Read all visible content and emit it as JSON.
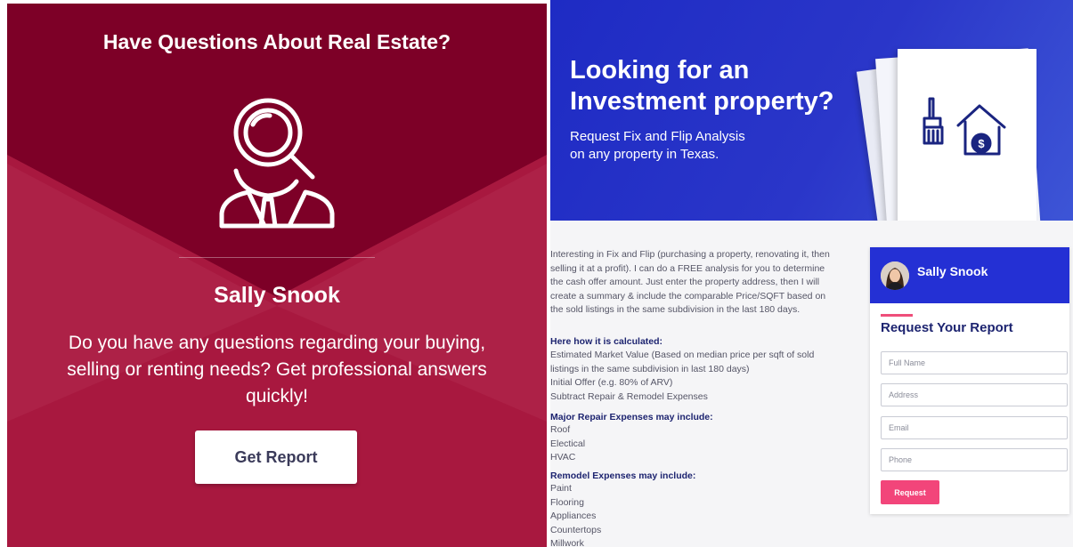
{
  "left_card": {
    "title": "Have Questions About Real Estate?",
    "agent_name": "Sally Snook",
    "body": "Do you have any questions regarding your buying, selling or renting needs? Get professional answers quickly!",
    "button_label": "Get Report",
    "icon": "agent-search-icon",
    "colors": {
      "dark": "#7d0027",
      "mid": "#a8183f",
      "light": "#b0294f"
    }
  },
  "right_page": {
    "hero": {
      "title_line1": "Looking for an",
      "title_line2": "Investment property?",
      "subtitle_line1": "Request Fix and Flip Analysis",
      "subtitle_line2": "on any property in Texas.",
      "icon": "fix-and-flip-house-icon",
      "color": "#2430d4"
    },
    "intro": "Interesting in Fix and Flip (purchasing a property, renovating it, then selling it at a profit). I can do a FREE analysis for you to determine the cash offer amount. Just enter the property address, then I will create a summary & include the comparable Price/SQFT based on the sold listings in the same subdivision in the last 180 days.",
    "calculation": {
      "heading": "Here how it is calculated:",
      "items": [
        "Estimated Market Value (Based on median price per sqft of sold listings in the same subdivision in last 180 days)",
        "Initial Offer (e.g. 80% of ARV)",
        "Subtract Repair & Remodel Expenses"
      ]
    },
    "repair": {
      "heading": "Major Repair Expenses may include:",
      "items": [
        "Roof",
        "Electical",
        "HVAC"
      ]
    },
    "remodel": {
      "heading": "Remodel Expenses may include:",
      "items": [
        "Paint",
        "Flooring",
        "Appliances",
        "Countertops",
        "Millwork"
      ]
    },
    "form": {
      "agent_name": "Sally Snook",
      "heading": "Request Your Report",
      "full_name_placeholder": "Full Name",
      "address_placeholder": "Address",
      "email_placeholder": "Email",
      "phone_placeholder": "Phone",
      "submit_label": "Request",
      "accent_color": "#f2457a"
    }
  }
}
